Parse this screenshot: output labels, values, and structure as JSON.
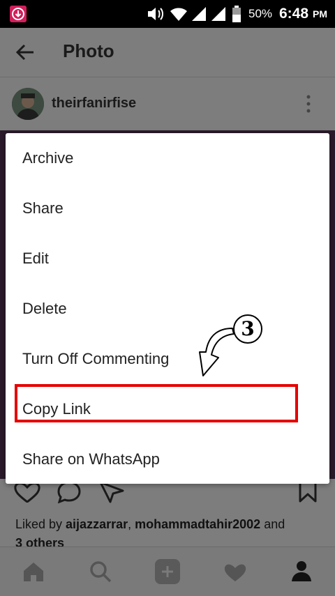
{
  "status_bar": {
    "battery": "50%",
    "time": "6:48",
    "ampm": "PM"
  },
  "header": {
    "title": "Photo"
  },
  "post": {
    "username": "theirfanirfise",
    "liked_prefix": "Liked by ",
    "liked_user1": "aijazzarrar",
    "liked_sep": ", ",
    "liked_user2": "mohammadtahir2002",
    "liked_and": " and",
    "liked_others": "3 others"
  },
  "menu": {
    "items": [
      {
        "label": "Archive"
      },
      {
        "label": "Share"
      },
      {
        "label": "Edit"
      },
      {
        "label": "Delete"
      },
      {
        "label": "Turn Off Commenting"
      },
      {
        "label": "Copy Link"
      },
      {
        "label": "Share on WhatsApp"
      }
    ]
  },
  "annotation": {
    "step": "3"
  },
  "icons": {
    "back": "back-arrow-icon",
    "more": "more-vertical-icon",
    "like": "heart-outline-icon",
    "comment": "comment-icon",
    "direct": "send-icon",
    "save": "bookmark-icon",
    "home": "home-icon",
    "search": "search-icon",
    "add": "add-icon",
    "activity": "heart-icon",
    "profile": "profile-icon"
  },
  "colors": {
    "highlight": "#e60000",
    "scrim": "#7a7a7a"
  }
}
